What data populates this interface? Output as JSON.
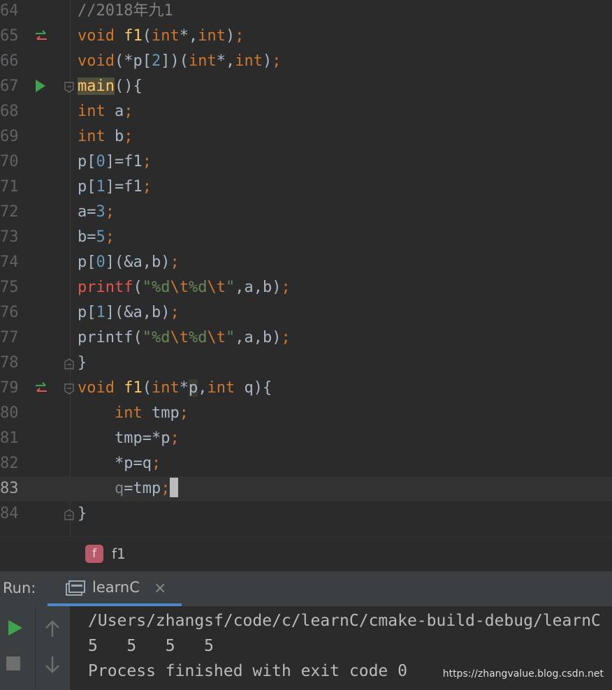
{
  "editor": {
    "lines": [
      {
        "num": "64",
        "text": "//2018年九1"
      },
      {
        "num": "65",
        "text": "void f1(int*,int);"
      },
      {
        "num": "66",
        "text": "void(*p[2])(int*,int);"
      },
      {
        "num": "67",
        "text": "main(){"
      },
      {
        "num": "68",
        "text": "int a;"
      },
      {
        "num": "69",
        "text": "int b;"
      },
      {
        "num": "70",
        "text": "p[0]=f1;"
      },
      {
        "num": "71",
        "text": "p[1]=f1;"
      },
      {
        "num": "72",
        "text": "a=3;"
      },
      {
        "num": "73",
        "text": "b=5;"
      },
      {
        "num": "74",
        "text": "p[0](&a,b);"
      },
      {
        "num": "75",
        "text": "printf(\"%d\\t%d\\t\",a,b);"
      },
      {
        "num": "76",
        "text": "p[1](&a,b);"
      },
      {
        "num": "77",
        "text": "printf(\"%d\\t%d\\t\",a,b);"
      },
      {
        "num": "78",
        "text": "}"
      },
      {
        "num": "79",
        "text": "void f1(int*p,int q){"
      },
      {
        "num": "80",
        "text": "    int tmp;"
      },
      {
        "num": "81",
        "text": "    tmp=*p;"
      },
      {
        "num": "82",
        "text": "    *p=q;"
      },
      {
        "num": "83",
        "text": "    q=tmp;"
      },
      {
        "num": "84",
        "text": "}"
      }
    ]
  },
  "breadcrumb": {
    "badge": "f",
    "label": "f1"
  },
  "run_panel": {
    "label": "Run:",
    "tab_label": "learnC",
    "tab_close": "×",
    "console": [
      "/Users/zhangsf/code/c/learnC/cmake-build-debug/learnC",
      "5   5   5   5",
      "Process finished with exit code 0"
    ]
  },
  "watermark": "https://zhangvalue.blog.csdn.net",
  "colors": {
    "background": "#2b2b2b",
    "keyword": "#cc7832",
    "function": "#ffc66d",
    "number": "#6897bb",
    "string": "#6a8759",
    "run_green": "#3fa34d",
    "tab_accent": "#4a88c7"
  },
  "icons": {
    "line65": "implements-arrows-icon",
    "line67": "run-gutter-icon",
    "line79": "implements-arrows-icon",
    "toolbar": [
      "run-icon",
      "stop-icon",
      "scroll-up-icon",
      "scroll-down-icon"
    ]
  }
}
